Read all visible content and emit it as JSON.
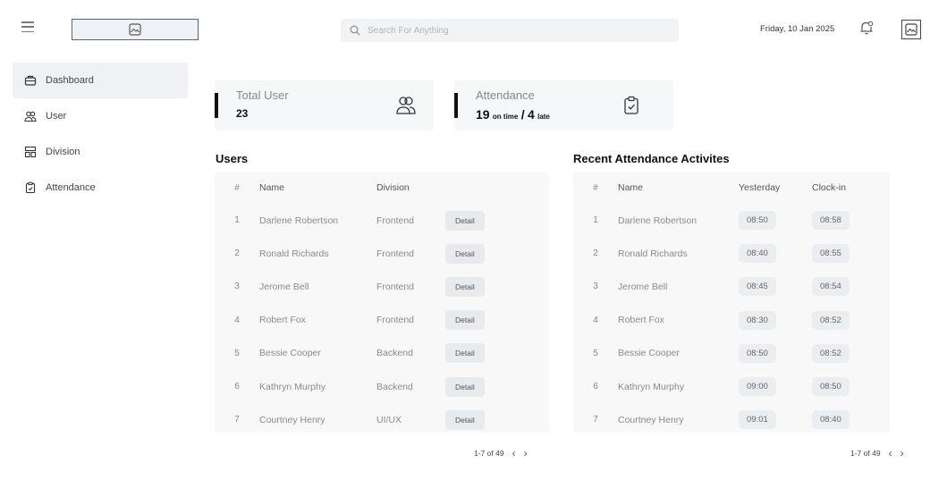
{
  "header": {
    "search_placeholder": "Search For Anything",
    "date": "Friday, 10 Jan 2025"
  },
  "sidebar": {
    "items": [
      {
        "label": "Dashboard",
        "icon": "briefcase-icon",
        "active": true
      },
      {
        "label": "User",
        "icon": "users-icon"
      },
      {
        "label": "Division",
        "icon": "division-icon"
      },
      {
        "label": "Attendance",
        "icon": "clipboard-check-icon"
      }
    ]
  },
  "cards": {
    "total_user": {
      "title": "Total User",
      "value": "23"
    },
    "attendance": {
      "title": "Attendance",
      "on_time": "19",
      "on_time_label": "on time",
      "sep": "/",
      "late": "4",
      "late_label": "late"
    }
  },
  "users": {
    "title": "Users",
    "columns": [
      "#",
      "Name",
      "Division"
    ],
    "detail_label": "Detail",
    "rows": [
      {
        "no": "1",
        "name": "Darlene Robertson",
        "division": "Frontend"
      },
      {
        "no": "2",
        "name": "Ronald Richards",
        "division": "Frontend"
      },
      {
        "no": "3",
        "name": "Jerome Bell",
        "division": "Frontend"
      },
      {
        "no": "4",
        "name": "Robert Fox",
        "division": "Frontend"
      },
      {
        "no": "5",
        "name": "Bessie Cooper",
        "division": "Backend"
      },
      {
        "no": "6",
        "name": "Kathryn Murphy",
        "division": "Backend"
      },
      {
        "no": "7",
        "name": "Courtney Henry",
        "division": "UI/UX"
      }
    ],
    "pager": "1-7 of 49"
  },
  "attendance_recent": {
    "title": "Recent Attendance Activites",
    "columns": [
      "#",
      "Name",
      "Yesterday",
      "Clock-in"
    ],
    "rows": [
      {
        "no": "1",
        "name": "Darlene Robertson",
        "yesterday": "08:50",
        "clock_in": "08:58"
      },
      {
        "no": "2",
        "name": "Ronald Richards",
        "yesterday": "08:40",
        "clock_in": "08:55"
      },
      {
        "no": "3",
        "name": "Jerome Bell",
        "yesterday": "08:45",
        "clock_in": "08:54"
      },
      {
        "no": "4",
        "name": "Robert Fox",
        "yesterday": "08:30",
        "clock_in": "08:52"
      },
      {
        "no": "5",
        "name": "Bessie Cooper",
        "yesterday": "08:50",
        "clock_in": "08:52"
      },
      {
        "no": "6",
        "name": "Kathryn Murphy",
        "yesterday": "09:00",
        "clock_in": "08:50"
      },
      {
        "no": "7",
        "name": "Courtney Henry",
        "yesterday": "09:01",
        "clock_in": "08:40"
      }
    ],
    "pager": "1-7 of 49"
  }
}
